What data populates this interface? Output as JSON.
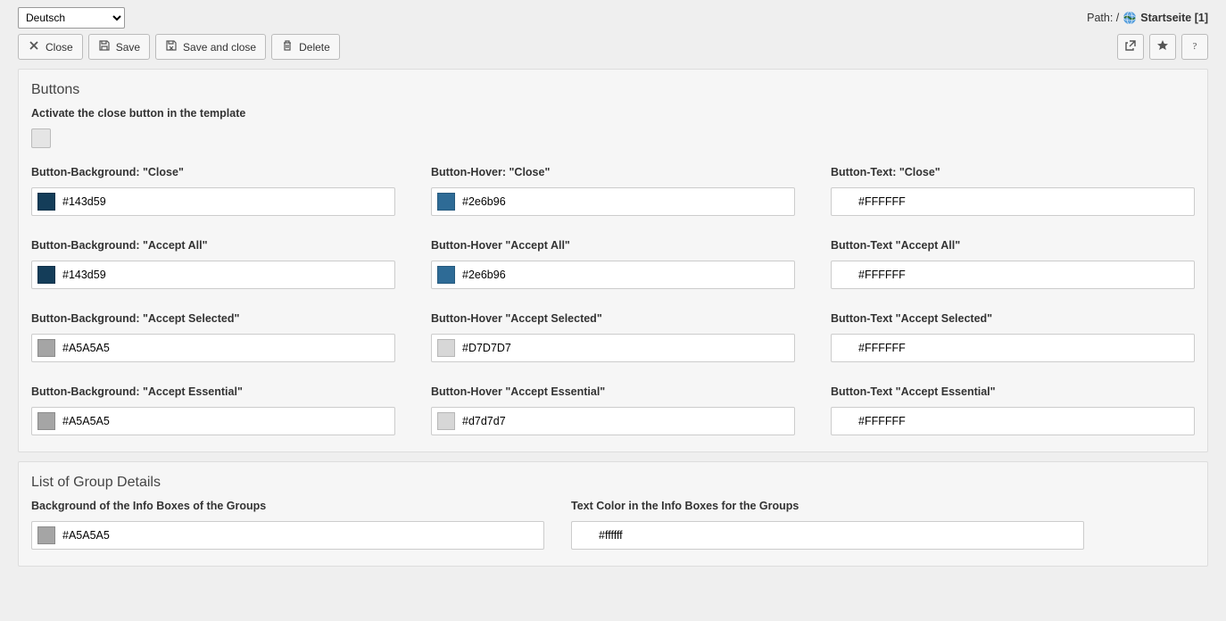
{
  "header": {
    "languageOptions": [
      "Deutsch"
    ],
    "pathPrefix": "Path: /",
    "pageName": "Startseite [1]"
  },
  "toolbar": {
    "close": "Close",
    "save": "Save",
    "saveClose": "Save and close",
    "delete": "Delete"
  },
  "buttonsPanel": {
    "title": "Buttons",
    "activateLabel": "Activate the close button in the template",
    "rows": [
      {
        "bgLabel": "Button-Background: \"Close\"",
        "bg": "#143d59",
        "hoverLabel": "Button-Hover: \"Close\"",
        "hover": "#2e6b96",
        "textLabel": "Button-Text: \"Close\"",
        "text": "#FFFFFF"
      },
      {
        "bgLabel": "Button-Background: \"Accept All\"",
        "bg": "#143d59",
        "hoverLabel": "Button-Hover \"Accept All\"",
        "hover": "#2e6b96",
        "textLabel": "Button-Text \"Accept All\"",
        "text": "#FFFFFF"
      },
      {
        "bgLabel": "Button-Background: \"Accept Selected\"",
        "bg": "#A5A5A5",
        "hoverLabel": "Button-Hover \"Accept Selected\"",
        "hover": "#D7D7D7",
        "textLabel": "Button-Text \"Accept Selected\"",
        "text": "#FFFFFF"
      },
      {
        "bgLabel": "Button-Background: \"Accept Essential\"",
        "bg": "#A5A5A5",
        "hoverLabel": "Button-Hover \"Accept Essential\"",
        "hover": "#d7d7d7",
        "textLabel": "Button-Text \"Accept Essential\"",
        "text": "#FFFFFF"
      }
    ]
  },
  "groupPanel": {
    "title": "List of Group Details",
    "bgLabel": "Background of the Info Boxes of the Groups",
    "bg": "#A5A5A5",
    "textLabel": "Text Color in the Info Boxes for the Groups",
    "text": "#ffffff"
  }
}
